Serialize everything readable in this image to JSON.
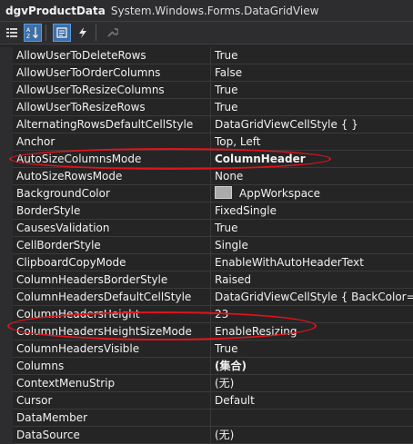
{
  "header": {
    "object_name": "dgvProductData",
    "object_type": "System.Windows.Forms.DataGridView"
  },
  "toolbar": {
    "buttons": [
      {
        "icon": "categorized-icon",
        "glyph": "☷",
        "active": false
      },
      {
        "icon": "alphabetical-icon",
        "glyph": "↕",
        "active": true
      },
      {
        "icon": "properties-icon",
        "glyph": "▤",
        "active": true
      },
      {
        "icon": "events-icon",
        "glyph": "⚡",
        "active": false
      },
      {
        "icon": "property-pages-icon",
        "glyph": "🔧",
        "active": false
      }
    ]
  },
  "properties": [
    {
      "name": "AllowUserToDeleteRows",
      "value": "True"
    },
    {
      "name": "AllowUserToOrderColumns",
      "value": "False"
    },
    {
      "name": "AllowUserToResizeColumns",
      "value": "True"
    },
    {
      "name": "AllowUserToResizeRows",
      "value": "True"
    },
    {
      "name": "AlternatingRowsDefaultCellStyle",
      "value": "DataGridViewCellStyle { }"
    },
    {
      "name": "Anchor",
      "value": "Top, Left"
    },
    {
      "name": "AutoSizeColumnsMode",
      "value": "ColumnHeader",
      "bold": true
    },
    {
      "name": "AutoSizeRowsMode",
      "value": "None"
    },
    {
      "name": "BackgroundColor",
      "value": "AppWorkspace",
      "swatch": "#ababab"
    },
    {
      "name": "BorderStyle",
      "value": "FixedSingle"
    },
    {
      "name": "CausesValidation",
      "value": "True"
    },
    {
      "name": "CellBorderStyle",
      "value": "Single"
    },
    {
      "name": "ClipboardCopyMode",
      "value": "EnableWithAutoHeaderText"
    },
    {
      "name": "ColumnHeadersBorderStyle",
      "value": "Raised"
    },
    {
      "name": "ColumnHeadersDefaultCellStyle",
      "value": "DataGridViewCellStyle { BackColor=Co"
    },
    {
      "name": "ColumnHeadersHeight",
      "value": "23"
    },
    {
      "name": "ColumnHeadersHeightSizeMode",
      "value": "EnableResizing"
    },
    {
      "name": "ColumnHeadersVisible",
      "value": "True"
    },
    {
      "name": "Columns",
      "value": "(集合)",
      "bold": true
    },
    {
      "name": "ContextMenuStrip",
      "value": "(无)"
    },
    {
      "name": "Cursor",
      "value": "Default"
    },
    {
      "name": "DataMember",
      "value": ""
    },
    {
      "name": "DataSource",
      "value": "(无)"
    }
  ],
  "annotation_color": "#e0141a"
}
